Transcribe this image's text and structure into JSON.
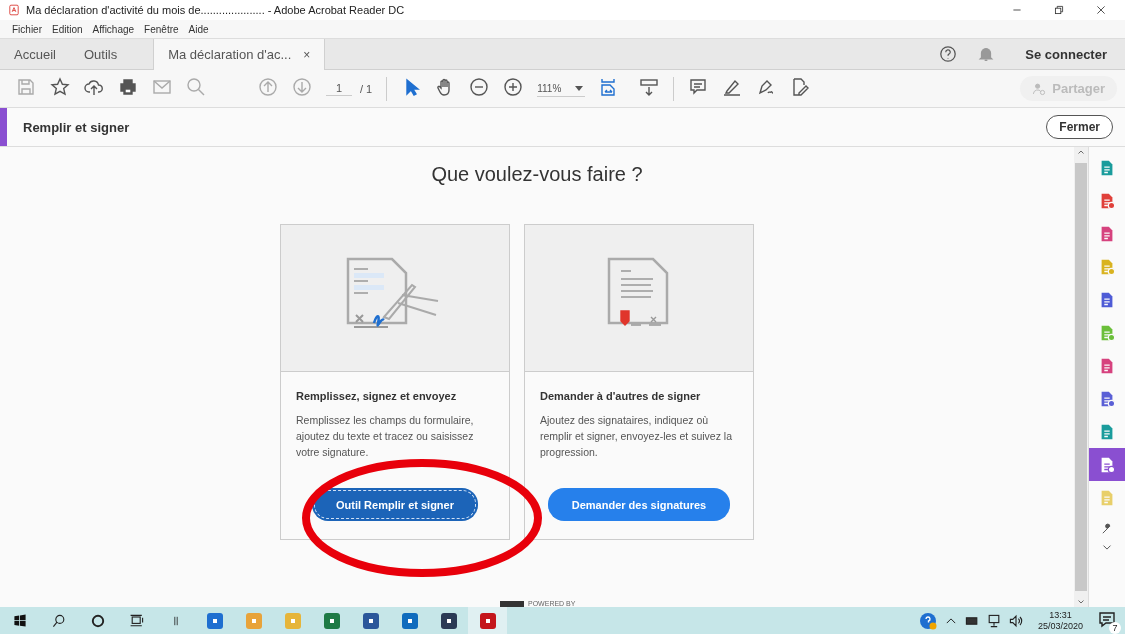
{
  "window": {
    "title": "Ma déclaration d'activité du mois de..................... - Adobe Acrobat Reader DC"
  },
  "menu": [
    "Fichier",
    "Edition",
    "Affichage",
    "Fenêtre",
    "Aide"
  ],
  "tabs": [
    {
      "label": "Accueil",
      "selected": false,
      "kind": "nav"
    },
    {
      "label": "Outils",
      "selected": false,
      "kind": "nav"
    },
    {
      "label": "Ma déclaration d'ac...",
      "selected": true,
      "kind": "doc",
      "close": "×"
    }
  ],
  "account": {
    "sign_in": "Se connecter"
  },
  "toolbar": {
    "page": "1",
    "total": "/ 1",
    "zoom": "111%",
    "share": {
      "label": "Partager",
      "disabled": true
    }
  },
  "tool_header": {
    "title": "Remplir et signer",
    "close": "Fermer"
  },
  "content": {
    "heading": "Que voulez-vous faire ?",
    "footer": "POWERED BY"
  },
  "cards": [
    {
      "kind": "fill",
      "title": "Remplissez, signez et envoyez",
      "description": "Remplissez les champs du formulaire, ajoutez du texte et tracez ou saisissez votre signature.",
      "button": "Outil Remplir et signer",
      "focused": true
    },
    {
      "kind": "request",
      "title": "Demander à d'autres de signer",
      "description": "Ajoutez des signataires, indiquez où remplir et signer, envoyez-les et suivez la progression.",
      "button": "Demander des signatures",
      "focused": false
    }
  ],
  "right_rail": [
    {
      "color": "#1a9c9c",
      "selected": false
    },
    {
      "color": "#e0403a",
      "selected": false
    },
    {
      "color": "#d6427e",
      "selected": false
    },
    {
      "color": "#d9b320",
      "selected": false
    },
    {
      "color": "#4e5bd6",
      "selected": false
    },
    {
      "color": "#6bbf3a",
      "selected": false
    },
    {
      "color": "#d6427e",
      "selected": false
    },
    {
      "color": "#5a5fd6",
      "selected": false
    },
    {
      "color": "#1a9c9c",
      "selected": false
    },
    {
      "color": "#8a4fd1",
      "selected": true
    },
    {
      "color": "#e8cf6a",
      "selected": false
    }
  ],
  "taskbar": {
    "apps": [
      {
        "color": "#1f6fd0",
        "active": false
      },
      {
        "color": "#e8a33a",
        "active": false
      },
      {
        "color": "#e6b53a",
        "active": false
      },
      {
        "color": "#1e7a45",
        "active": false
      },
      {
        "color": "#2b579a",
        "active": false
      },
      {
        "color": "#0f6cbd",
        "active": false
      },
      {
        "color": "#2b3a55",
        "active": false
      },
      {
        "color": "#c4161c",
        "active": true
      }
    ],
    "time": "13:31",
    "date": "25/03/2020",
    "notifications": "7"
  }
}
